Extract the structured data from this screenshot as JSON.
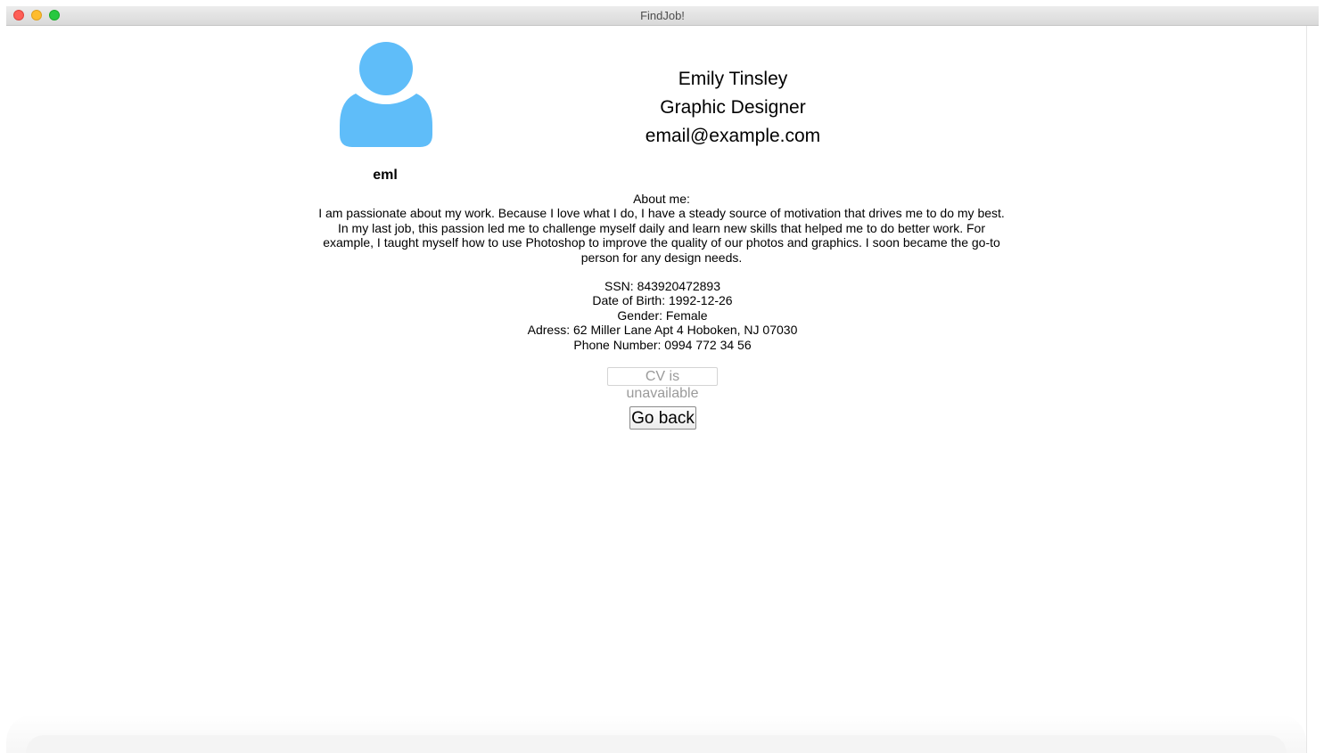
{
  "window": {
    "title": "FindJob!"
  },
  "profile": {
    "username": "eml",
    "name": "Emily Tinsley",
    "role": "Graphic Designer",
    "email": "email@example.com",
    "avatar_icon": "user-silhouette-icon",
    "avatar_color": "#5fbdf9"
  },
  "about": {
    "label": "About me:",
    "text": "I am passionate about my work. Because I love what I do, I have a steady source of motivation that drives me to do my best. In my last job, this passion led me to challenge myself daily and learn new skills that helped me to do better work. For example, I taught myself how to use Photoshop to improve the quality of our photos and graphics. I soon became the go-to person for any design needs."
  },
  "details": {
    "ssn": "SSN: 843920472893",
    "dob": "Date of Birth: 1992-12-26",
    "gender": "Gender: Female",
    "address": "Adress: 62 Miller Lane Apt 4 Hoboken, NJ 07030",
    "phone": "Phone Number: 0994 772 34 56"
  },
  "actions": {
    "cv_label": "CV is unavailable",
    "back_label": "Go back"
  }
}
